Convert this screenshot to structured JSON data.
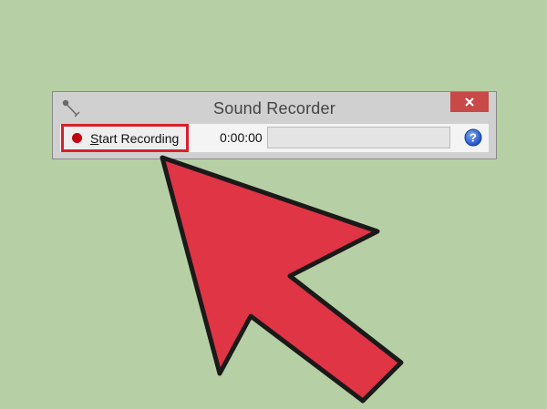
{
  "window": {
    "title": "Sound Recorder",
    "app_icon": "microphone-icon",
    "close_icon": "close-icon"
  },
  "toolbar": {
    "record_icon": "record-dot-icon",
    "start_label_mnemonic": "S",
    "start_label_rest": "tart Recording",
    "elapsed_time": "0:00:00",
    "level_meter_value": 0,
    "help_icon": "help-icon"
  },
  "overlay": {
    "arrow_icon": "arrow-pointer-icon",
    "highlight_color": "#d8202a",
    "arrow_color": "#e03545"
  },
  "colors": {
    "background": "#b7cfa4",
    "window_chrome": "#d0d0d0",
    "close_button": "#c94848",
    "help_button": "#2a5fd0"
  }
}
